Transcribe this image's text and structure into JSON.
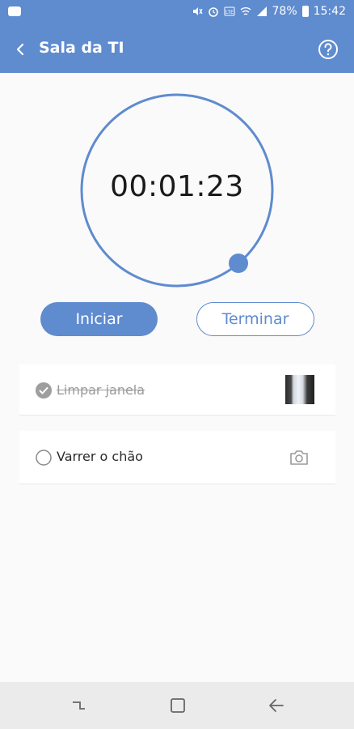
{
  "status_bar": {
    "battery": "78%",
    "time": "15:42"
  },
  "header": {
    "title": "Sala da TI"
  },
  "timer": {
    "value": "00:01:23"
  },
  "buttons": {
    "start_label": "Iniciar",
    "finish_label": "Terminar"
  },
  "tasks": [
    {
      "label": "Limpar janela",
      "done": true,
      "has_photo": true
    },
    {
      "label": "Varrer o chão",
      "done": false,
      "has_photo": false
    }
  ],
  "colors": {
    "accent": "#5f8bcf",
    "done_check": "#9e9e9e"
  },
  "icons": {
    "back": "arrow-left-icon",
    "help": "help-circle-icon",
    "camera": "camera-icon"
  }
}
